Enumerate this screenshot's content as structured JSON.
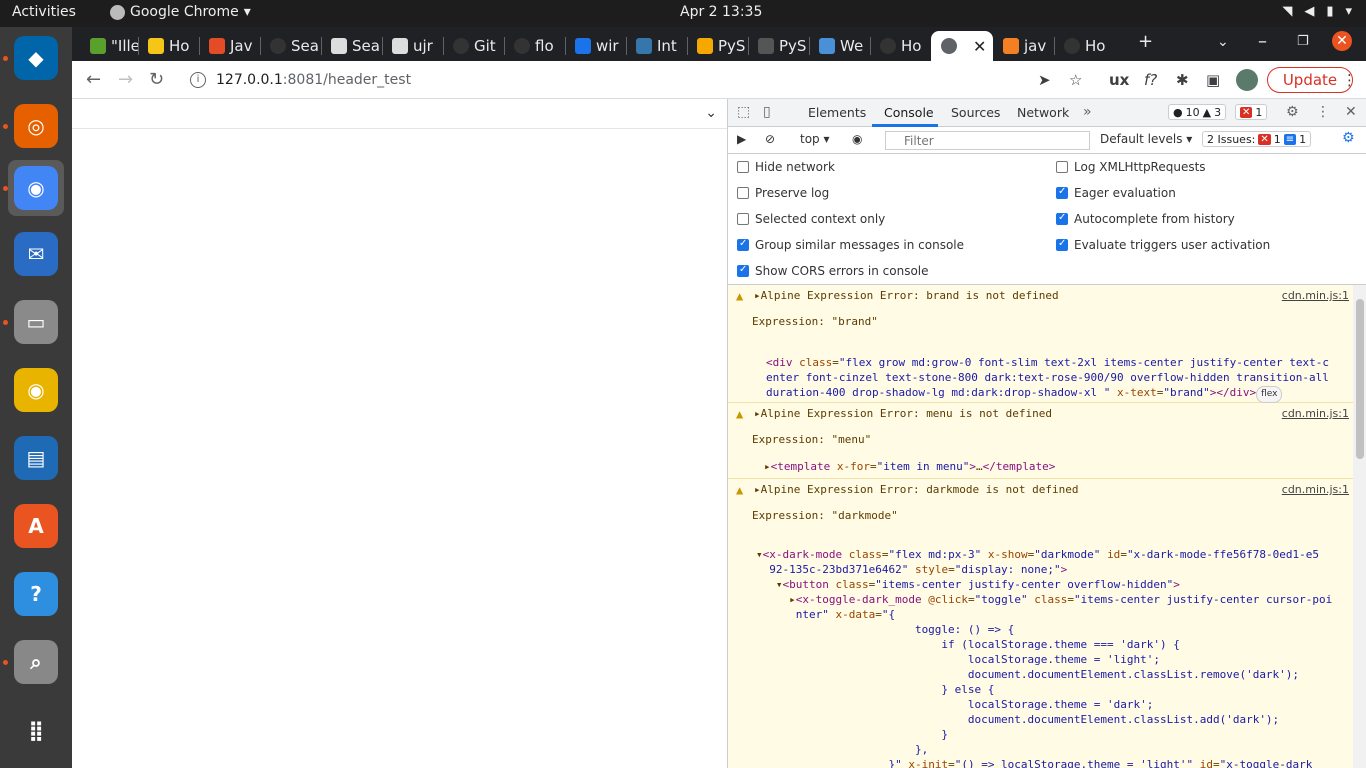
{
  "topbar": {
    "activities": "Activities",
    "app_name": "Google Chrome",
    "clock": "Apr 2  13:35"
  },
  "dock": {
    "items": [
      {
        "name": "vscode",
        "color": "#0065a9"
      },
      {
        "name": "firefox",
        "color": "#e66000"
      },
      {
        "name": "chrome",
        "color": "#4285f4"
      },
      {
        "name": "thunderbird",
        "color": "#2a6cc4"
      },
      {
        "name": "files",
        "color": "#8a8a8a"
      },
      {
        "name": "rhythmbox",
        "color": "#e8b400"
      },
      {
        "name": "writer",
        "color": "#1f6ab5"
      },
      {
        "name": "software",
        "color": "#e95420"
      },
      {
        "name": "help",
        "color": "#2e8fe0"
      },
      {
        "name": "screenshot",
        "color": "#888"
      },
      {
        "name": "apps-grid",
        "color": "#3a3a3a"
      }
    ]
  },
  "tabs": [
    {
      "label": "\"Ille",
      "color": "#5aa02c"
    },
    {
      "label": "Ho",
      "color": "#f5c518"
    },
    {
      "label": "Jav",
      "color": "#e34c26"
    },
    {
      "label": "Sea",
      "color": "#333333"
    },
    {
      "label": "Sea",
      "color": "#dddddd"
    },
    {
      "label": "ujr",
      "color": "#dddddd"
    },
    {
      "label": "Git",
      "color": "#333333"
    },
    {
      "label": "flo",
      "color": "#333333"
    },
    {
      "label": "wir",
      "color": "#1a73e8"
    },
    {
      "label": "Int",
      "color": "#3776ab"
    },
    {
      "label": "PyS",
      "color": "#f7a800"
    },
    {
      "label": "PyS",
      "color": "#555555"
    },
    {
      "label": "We",
      "color": "#4a90d9"
    },
    {
      "label": "Ho",
      "color": "#333333"
    },
    {
      "label": "",
      "color": "#5f6368",
      "active": true
    },
    {
      "label": "jav",
      "color": "#f48024"
    },
    {
      "label": "Ho",
      "color": "#333333"
    }
  ],
  "omnibox": {
    "host": "127.0.0.1",
    "path": ":8081/header_test"
  },
  "update_label": "Update",
  "devtools": {
    "tabs": [
      "Elements",
      "Console",
      "Sources",
      "Network"
    ],
    "warn_count": "10",
    "triangle_count": "3",
    "error_count": "1",
    "context": "top",
    "filter_placeholder": "Filter",
    "levels": "Default levels",
    "issues_label": "2 Issues:",
    "issues_err": "1",
    "issues_info": "1",
    "options_left": [
      {
        "label": "Hide network",
        "checked": false
      },
      {
        "label": "Preserve log",
        "checked": false
      },
      {
        "label": "Selected context only",
        "checked": false
      },
      {
        "label": "Group similar messages in console",
        "checked": true
      },
      {
        "label": "Show CORS errors in console",
        "checked": true
      }
    ],
    "options_right": [
      {
        "label": "Log XMLHttpRequests",
        "checked": false
      },
      {
        "label": "Eager evaluation",
        "checked": true
      },
      {
        "label": "Autocomplete from history",
        "checked": true
      },
      {
        "label": "Evaluate triggers user activation",
        "checked": true
      }
    ]
  },
  "console": {
    "source": "cdn.min.js:1",
    "msg1": {
      "head": "Alpine Expression Error: brand is not defined",
      "expr": "Expression: \"brand\""
    },
    "msg2": {
      "head": "Alpine Expression Error: menu is not defined",
      "expr": "Expression: \"menu\""
    },
    "msg3": {
      "head": "Alpine Expression Error: darkmode is not defined",
      "expr": "Expression: \"darkmode\""
    },
    "flex_badge": "flex"
  }
}
